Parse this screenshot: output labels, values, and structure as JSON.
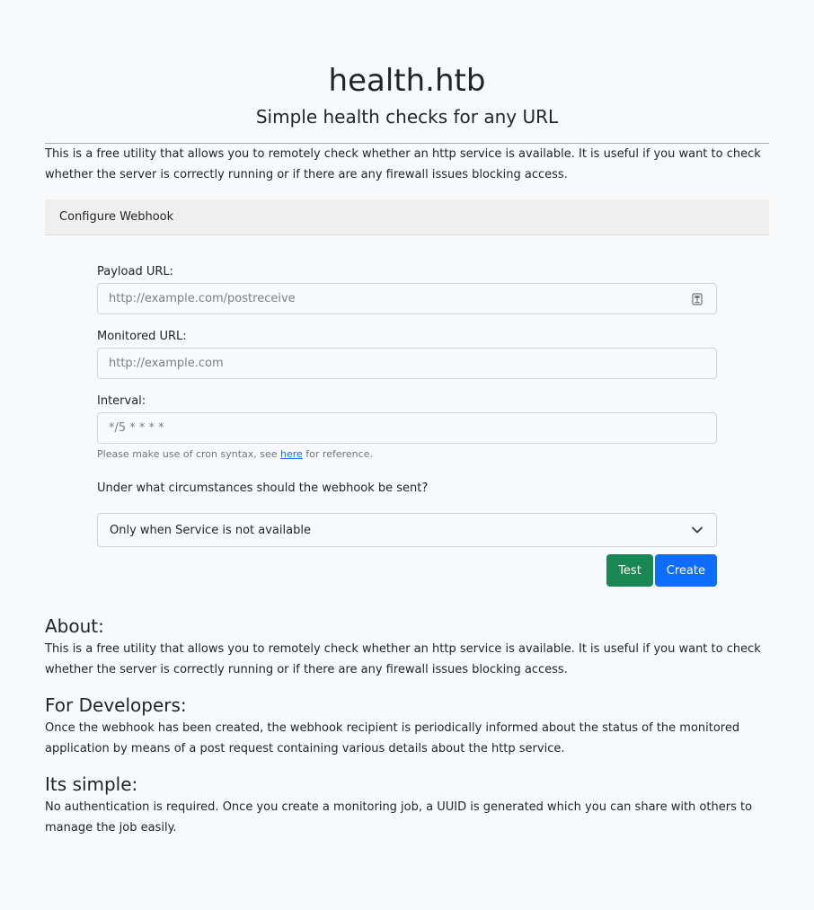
{
  "header": {
    "title": "health.htb",
    "subtitle": "Simple health checks for any URL"
  },
  "intro": "This is a free utility that allows you to remotely check whether an http service is available. It is useful if you want to check whether the server is correctly running or if there are any firewall issues blocking access.",
  "webhook_card": {
    "title": "Configure Webhook"
  },
  "form": {
    "payload_url": {
      "label": "Payload URL:",
      "placeholder": "http://example.com/postreceive",
      "icon": "password-manager-icon"
    },
    "monitored_url": {
      "label": "Monitored URL:",
      "placeholder": "http://example.com"
    },
    "interval": {
      "label": "Interval:",
      "placeholder": "*/5 * * * *"
    },
    "hint": {
      "before": "Please make use of cron syntax, see ",
      "link": "here",
      "after": " for reference."
    },
    "question": "Under what circumstances should the webhook be sent?",
    "condition": {
      "selected": "Only when Service is not available"
    },
    "buttons": {
      "test": "Test",
      "create": "Create"
    }
  },
  "sections": {
    "about": {
      "heading": "About:",
      "text": "This is a free utility that allows you to remotely check whether an http service is available. It is useful if you want to check whether the server is correctly running or if there are any firewall issues blocking access."
    },
    "developers": {
      "heading": "For Developers:",
      "text": "Once the webhook has been created, the webhook recipient is periodically informed about the status of the monitored application by means of a post request containing various details about the http service."
    },
    "simple": {
      "heading": "Its simple:",
      "text": "No authentication is required. Once you create a monitoring job, a UUID is generated which you can share with others to manage the job easily."
    }
  },
  "colors": {
    "test_button": "#198754",
    "create_button": "#0d6efd",
    "link": "#0d6efd"
  }
}
